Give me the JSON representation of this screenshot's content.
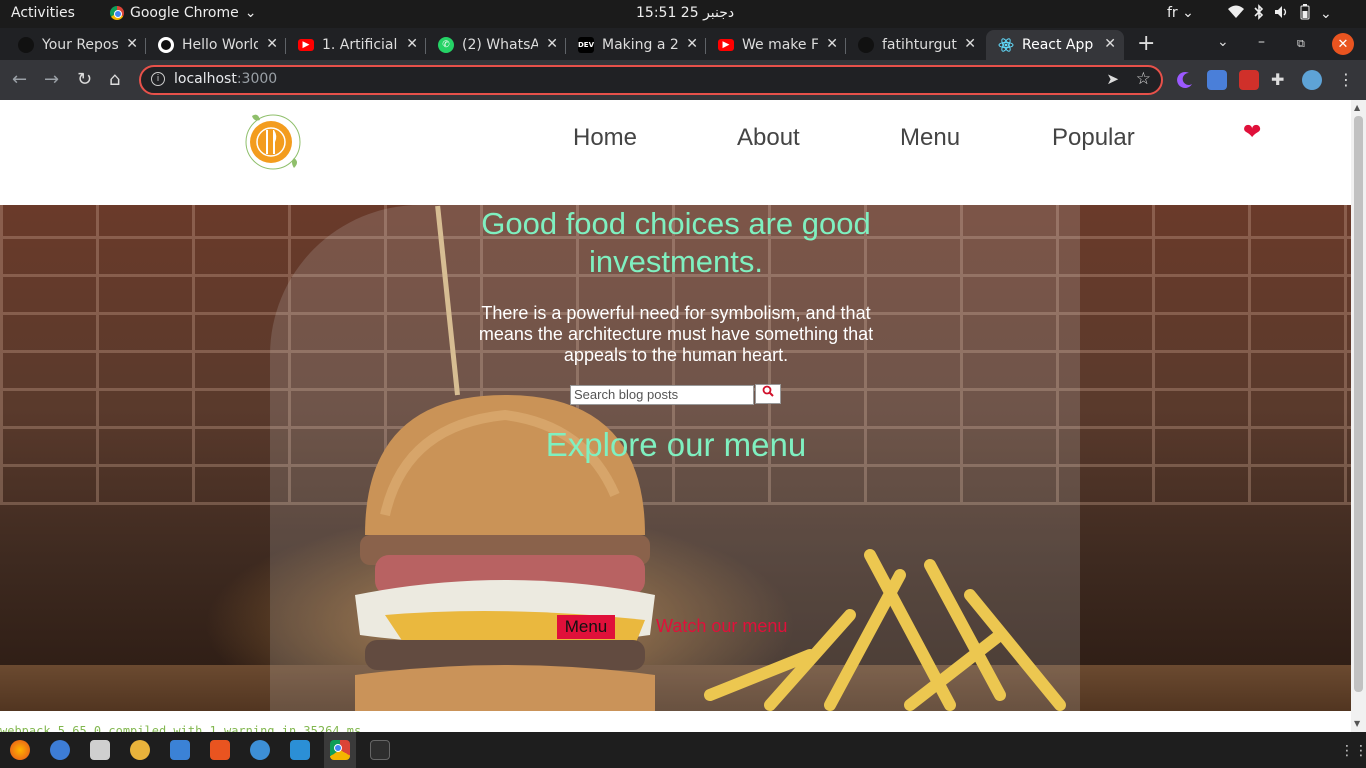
{
  "system_bar": {
    "activities": "Activities",
    "app_name": "Google Chrome",
    "clock": "15:51  25 دجنبر",
    "lang": "fr"
  },
  "tabs": [
    {
      "label": "Your Repos",
      "favicon": "github-icon"
    },
    {
      "label": "Hello World",
      "favicon": "github-icon"
    },
    {
      "label": "1. Artificial",
      "favicon": "youtube-icon"
    },
    {
      "label": "(2) WhatsApp",
      "favicon": "whatsapp-icon"
    },
    {
      "label": "Making a 2",
      "favicon": "dev-icon"
    },
    {
      "label": "We make Fr",
      "favicon": "youtube-icon"
    },
    {
      "label": "fatihturgut",
      "favicon": "github-icon"
    },
    {
      "label": "React App",
      "favicon": "react-icon",
      "active": true
    }
  ],
  "address_bar": {
    "host": "localhost",
    "port": ":3000"
  },
  "site": {
    "nav": [
      "Home",
      "About",
      "Menu",
      "Popular"
    ],
    "hero_title": "Good food choices are good investments.",
    "hero_subtitle": "There is a powerful need for symbolism, and that means the architecture must have something that appeals to the human heart.",
    "search_placeholder": "Search blog posts",
    "explore_heading": "Explore our menu",
    "menu_button": "Menu",
    "watch_link": "Watch our menu"
  },
  "terminal": "webpack 5.65.0 compiled with 1 warning in 35264 ms",
  "colors": {
    "accent_red": "#e0103a",
    "mint": "#7ff0c0",
    "logo_orange": "#f39c1e"
  }
}
